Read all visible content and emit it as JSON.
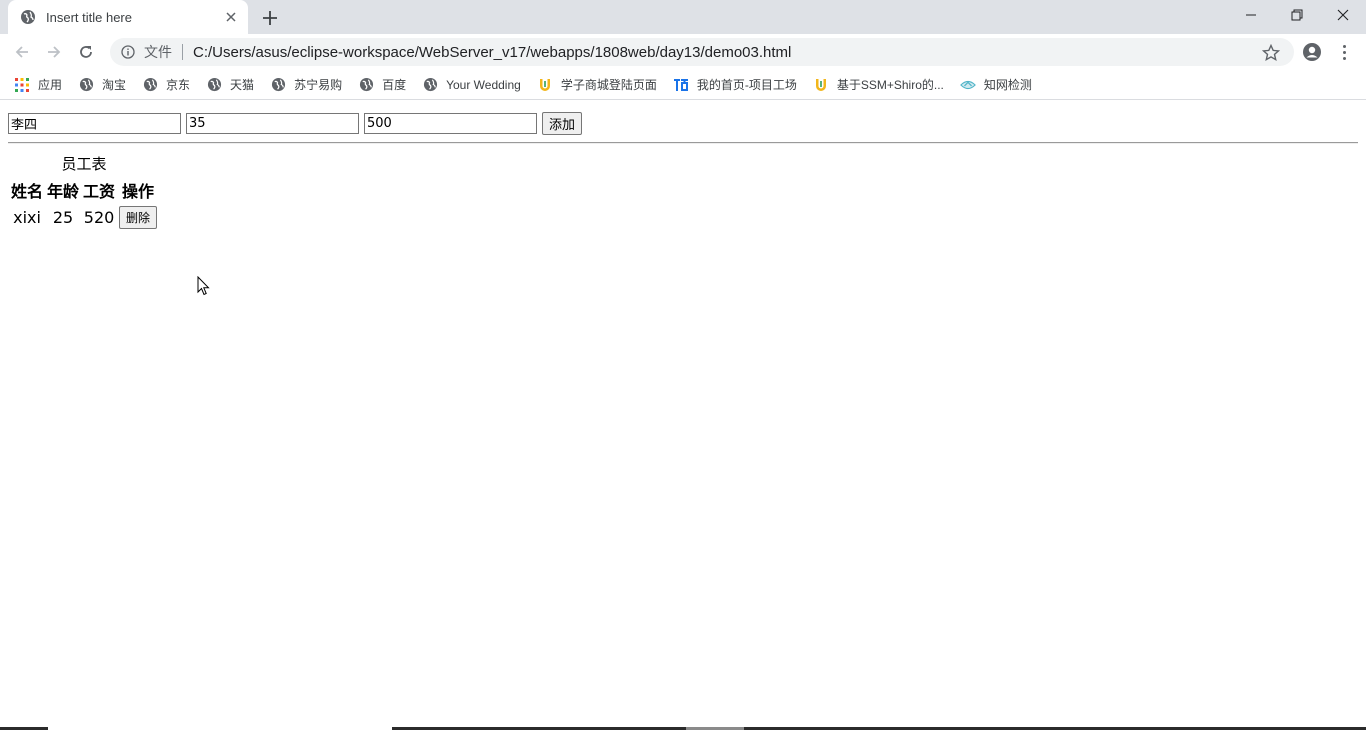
{
  "browser": {
    "tab_title": "Insert title here",
    "omnibox_file_label": "文件",
    "url": "C:/Users/asus/eclipse-workspace/WebServer_v17/webapps/1808web/day13/demo03.html"
  },
  "bookmarks": [
    {
      "label": "应用",
      "icon": "apps-grid-icon"
    },
    {
      "label": "淘宝",
      "icon": "globe-icon"
    },
    {
      "label": "京东",
      "icon": "globe-icon"
    },
    {
      "label": "天猫",
      "icon": "globe-icon"
    },
    {
      "label": "苏宁易购",
      "icon": "globe-icon"
    },
    {
      "label": "百度",
      "icon": "globe-icon"
    },
    {
      "label": "Your Wedding",
      "icon": "globe-icon"
    },
    {
      "label": "学子商城登陆页面",
      "icon": "u-logo-icon"
    },
    {
      "label": "我的首页-项目工场",
      "icon": "project-logo-icon"
    },
    {
      "label": "基于SSM+Shiro的...",
      "icon": "u-logo-icon"
    },
    {
      "label": "知网检测",
      "icon": "cnki-logo-icon"
    }
  ],
  "form": {
    "name_value": "李四",
    "age_value": "35",
    "salary_value": "500",
    "add_label": "添加"
  },
  "table": {
    "caption": "员工表",
    "headers": [
      "姓名",
      "年龄",
      "工资",
      "操作"
    ],
    "rows": [
      {
        "name": "xixi",
        "age": "25",
        "salary": "520",
        "action_label": "删除"
      }
    ]
  },
  "colors": {
    "tabstrip": "#dee1e6",
    "omnibox": "#f1f3f4",
    "u_logo": "#f2b61b",
    "project_logo": "#1a73e8",
    "cnki_logo": "#4fb4c8"
  }
}
